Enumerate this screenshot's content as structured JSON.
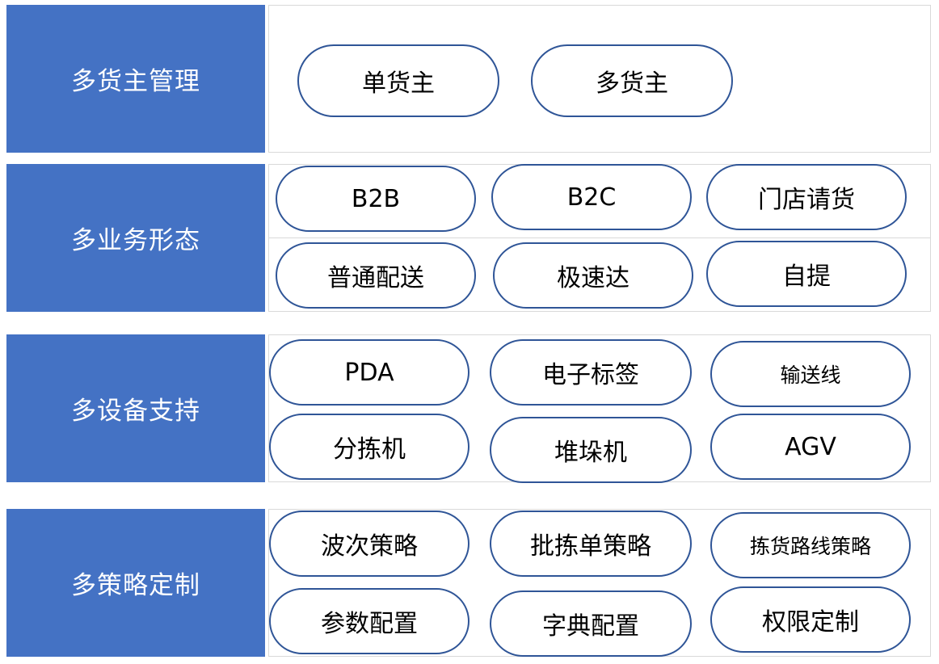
{
  "sections": [
    {
      "label": "多货主管理",
      "items": [
        "单货主",
        "多货主"
      ]
    },
    {
      "label": "多业务形态",
      "items": [
        "B2B",
        "B2C",
        "门店请货",
        "普通配送",
        "极速达",
        "自提"
      ]
    },
    {
      "label": "多设备支持",
      "items": [
        "PDA",
        "电子标签",
        "输送线",
        "分拣机",
        "堆垛机",
        "AGV"
      ]
    },
    {
      "label": "多策略定制",
      "items": [
        "波次策略",
        "批拣单策略",
        "拣货路线策略",
        "参数配置",
        "字典配置",
        "权限定制"
      ]
    }
  ],
  "colors": {
    "label_bg": "#4472c4",
    "pill_border": "#2f5597",
    "panel_border": "#d9d9d9"
  }
}
